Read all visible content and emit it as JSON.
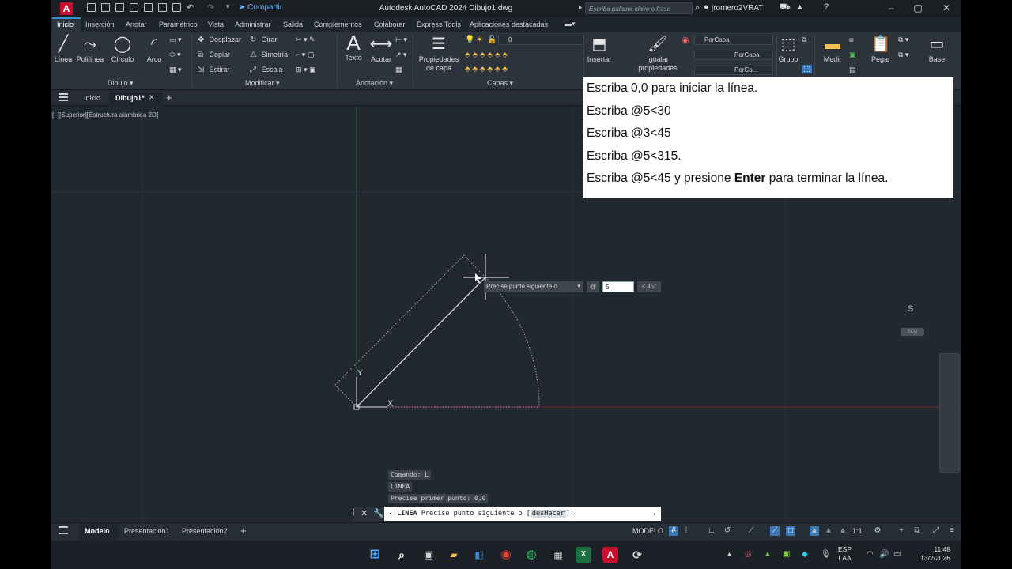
{
  "titlebar": {
    "share": "Compartir",
    "title": "Autodesk AutoCAD 2024   Dibujo1.dwg",
    "search_placeholder": "Escriba palabra clave o frase",
    "user": "jromero2VRAT"
  },
  "ribbon_tabs": [
    "Inicio",
    "Inserción",
    "Anotar",
    "Paramétrico",
    "Vista",
    "Administrar",
    "Salida",
    "Complementos",
    "Colaborar",
    "Express Tools",
    "Aplicaciones destacadas"
  ],
  "ribbon": {
    "draw": {
      "line": "Línea",
      "polyline": "Polilínea",
      "circle": "Círculo",
      "arc": "Arco",
      "panel": "Dibujo"
    },
    "modify": {
      "move": "Desplazar",
      "rotate": "Girar",
      "copy": "Copiar",
      "mirror": "Simetría",
      "stretch": "Estirar",
      "scale": "Escala",
      "panel": "Modificar"
    },
    "annotation": {
      "text": "Texto",
      "dimension": "Acotar",
      "panel": "Anotación"
    },
    "layers": {
      "layer_properties": "Propiedades de capa",
      "current_layer": "0",
      "panel": "Capas"
    },
    "block": {
      "insert": "Insertar"
    },
    "properties": {
      "match": "Igualar propiedades",
      "color": "PorCapa",
      "linetype": "PorCapa",
      "lineweight": "PorCa..."
    },
    "groups": {
      "group": "Grupo"
    },
    "utilities": {
      "measure": "Medir"
    },
    "clipboard": {
      "paste": "Pegar"
    },
    "view": {
      "base": "Base"
    }
  },
  "file_tabs": {
    "start": "Inicio",
    "drawing": "Dibujo1*"
  },
  "viewport_label": "[−][Superior][Estructura alámbrica 2D]",
  "instructions": {
    "l1": "Escriba 0,0 para iniciar la línea.",
    "l2": "Escriba @5<30",
    "l3": "Escriba @3<45",
    "l4": "Escriba @5<315.",
    "l5_pre": "Escriba @5<45 y presione ",
    "l5_bold": "Enter",
    "l5_post": " para terminar la línea."
  },
  "dynamic_input": {
    "prompt": "Precise punto siguiente o",
    "at": "@",
    "value": "5",
    "angle": "< 45°"
  },
  "ucs": {
    "y": "Y",
    "x": "X"
  },
  "viewcube": {
    "south": "S",
    "wcs": "SCU"
  },
  "command_history": [
    "Comando: L",
    "LINEA",
    "Precise primer punto: 0,0"
  ],
  "command_line": {
    "cmd": "LINEA",
    "prompt": "Precise punto siguiente o [",
    "option": "desHacer",
    "end": "]:"
  },
  "layout_tabs": {
    "model": "Modelo",
    "layout1": "Presentación1",
    "layout2": "Presentación2"
  },
  "status": {
    "model": "MODELO",
    "scale": "1:1"
  },
  "taskbar": {
    "lang1": "ESP",
    "lang2": "LAA",
    "time": "11:48",
    "date": "13/2/2026"
  },
  "colors": {
    "accent": "#3b8fd9",
    "background": "#212830",
    "autocad_red": "#c8102e"
  }
}
